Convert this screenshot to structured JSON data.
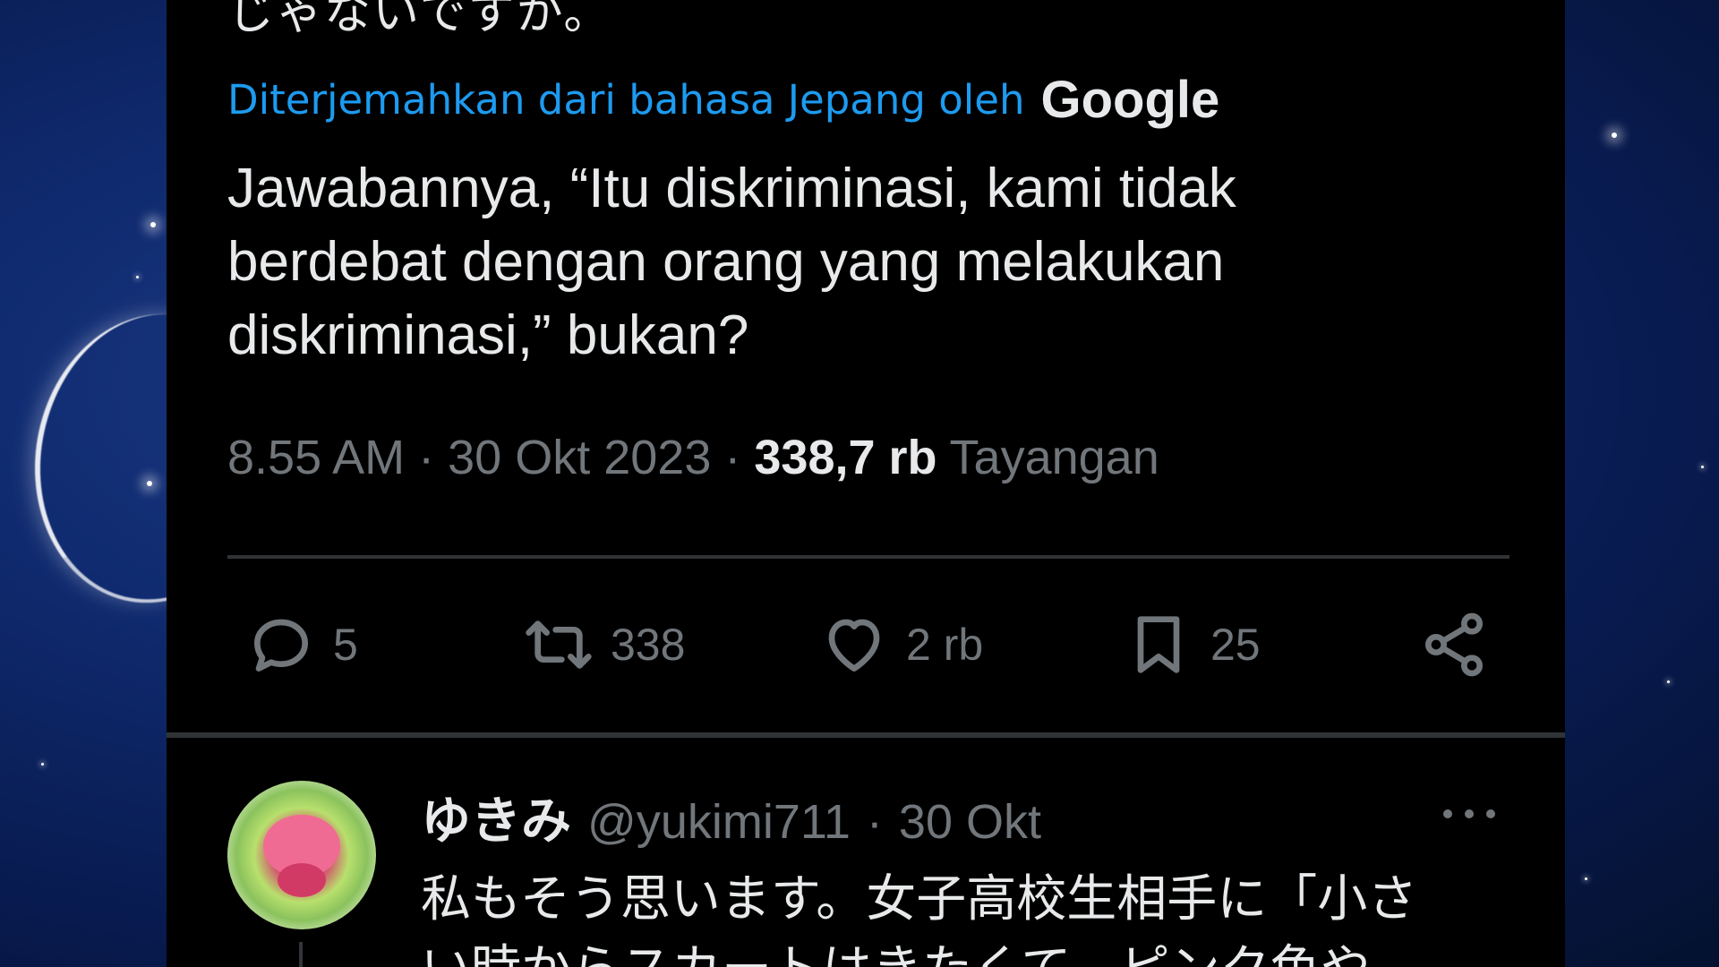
{
  "background": {
    "theme": "night-sky-stars",
    "colors": [
      "#1d3a86",
      "#081a4e"
    ]
  },
  "tweet": {
    "previous_text_fragment": "じゃないですか。",
    "translation_label": "Diterjemahkan dari bahasa Jepang oleh",
    "translation_provider": "Google",
    "text": "Jawabannya, “Itu diskriminasi, kami tidak\nberdebat dengan orang yang melakukan\ndiskriminasi,” bukan?",
    "time": "8.55 AM",
    "separator": "·",
    "date": "30 Okt 2023",
    "views_count": "338,7 rb",
    "views_label": "Tayangan",
    "actions": {
      "reply_count": "5",
      "repost_count": "338",
      "like_count": "2 rb",
      "bookmark_count": "25"
    },
    "icons": [
      "reply-icon",
      "repost-icon",
      "like-icon",
      "bookmark-icon",
      "share-icon"
    ]
  },
  "reply": {
    "display_name": "ゆきみ",
    "handle": "@yukimi711",
    "separator": "·",
    "date": "30 Okt",
    "text": "私もそう思います。女子高校生相手に「小さ\nい時からスカートはきたくて。ピンク色や",
    "avatar_icon": "rose-avatar"
  },
  "colors": {
    "accent": "#1d9bf0",
    "text_primary": "#e7e9ea",
    "text_secondary": "#71767b",
    "card_background": "#000000",
    "divider": "#2f3336"
  }
}
